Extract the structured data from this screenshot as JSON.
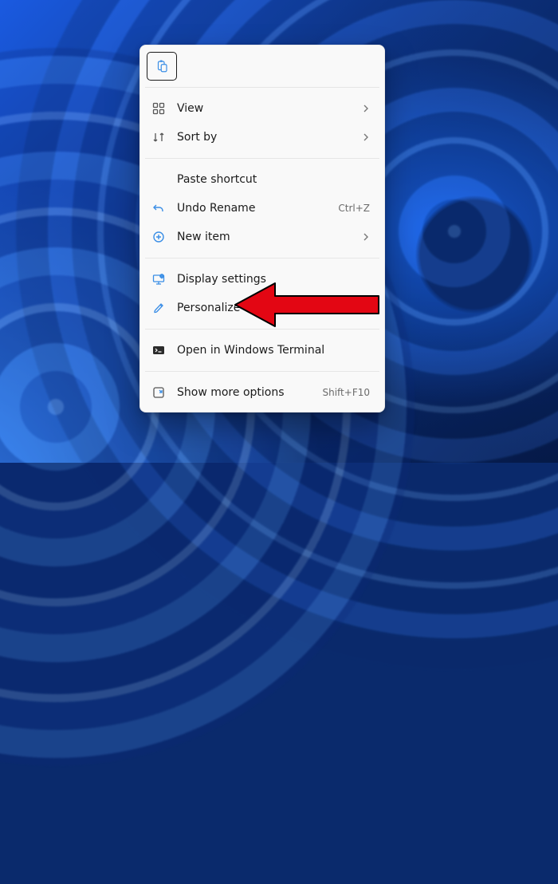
{
  "toolbar": {
    "paste_tooltip": "Paste"
  },
  "menu": {
    "view": {
      "label": "View",
      "has_submenu": true
    },
    "sort_by": {
      "label": "Sort by",
      "has_submenu": true
    },
    "paste_shortcut": {
      "label": "Paste shortcut"
    },
    "undo_rename": {
      "label": "Undo Rename",
      "accelerator": "Ctrl+Z"
    },
    "new_item": {
      "label": "New item",
      "has_submenu": true
    },
    "display_settings": {
      "label": "Display settings"
    },
    "personalize": {
      "label": "Personalize"
    },
    "open_terminal": {
      "label": "Open in Windows Terminal"
    },
    "show_more": {
      "label": "Show more options",
      "accelerator": "Shift+F10"
    }
  },
  "annotation": {
    "target": "personalize"
  },
  "colors": {
    "icon": "#3a8ee6",
    "arrow": "#e30613"
  }
}
